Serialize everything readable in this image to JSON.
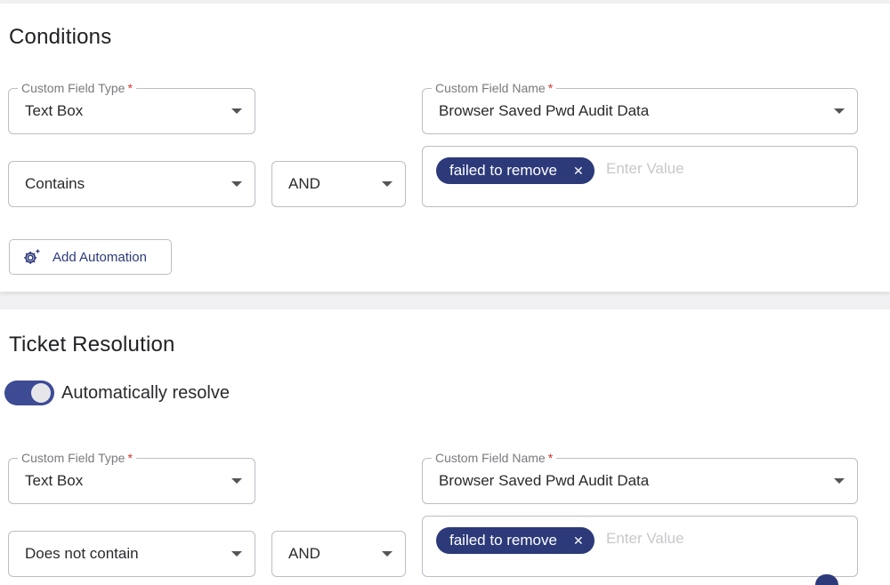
{
  "conditions": {
    "title": "Conditions",
    "custom_field_type": {
      "label": "Custom Field Type",
      "required_mark": "*",
      "value": "Text Box"
    },
    "custom_field_name": {
      "label": "Custom Field Name",
      "required_mark": "*",
      "value": "Browser Saved Pwd Audit Data"
    },
    "operator": {
      "value": "Contains"
    },
    "logic": {
      "value": "AND"
    },
    "values": {
      "chips": [
        "failed to remove"
      ],
      "placeholder": "Enter Value"
    },
    "add_automation": {
      "label": "Add Automation",
      "icon": "gear-sparkle-icon"
    }
  },
  "resolution": {
    "title": "Ticket Resolution",
    "auto_resolve": {
      "label": "Automatically resolve",
      "enabled": true
    },
    "custom_field_type": {
      "label": "Custom Field Type",
      "required_mark": "*",
      "value": "Text Box"
    },
    "custom_field_name": {
      "label": "Custom Field Name",
      "required_mark": "*",
      "value": "Browser Saved Pwd Audit Data"
    },
    "operator": {
      "value": "Does not contain"
    },
    "logic": {
      "value": "AND"
    },
    "values": {
      "chips": [
        "failed to remove"
      ],
      "placeholder": "Enter Value"
    }
  },
  "colors": {
    "accent": "#2c3a7a",
    "toggle_on": "#3d4b95",
    "required": "#d93025",
    "border": "#bdbdc4"
  }
}
